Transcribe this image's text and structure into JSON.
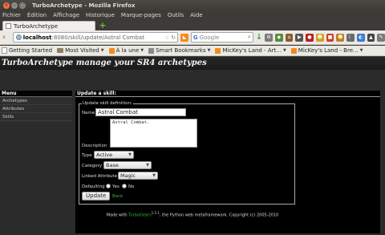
{
  "window": {
    "title": "TurboArchetype - Mozilla Firefox"
  },
  "menubar": [
    "Fichier",
    "Édition",
    "Affichage",
    "Historique",
    "Marque-pages",
    "Outils",
    "Aide"
  ],
  "tab": {
    "title": "TurboArchetype"
  },
  "navbar": {
    "url_host": "localhost",
    "url_rest": ":8080/skill/update/Astral Combat",
    "search_engine": "G",
    "search_placeholder": "Google"
  },
  "bookmarks": [
    {
      "label": "Getting Started",
      "icon": "page-icon",
      "caret": false
    },
    {
      "label": "Most Visited",
      "icon": "folder-icon",
      "caret": true
    },
    {
      "label": "À la une",
      "icon": "rss-icon",
      "caret": true
    },
    {
      "label": "Smart Bookmarks",
      "icon": "bars-icon",
      "caret": true
    },
    {
      "label": "MicKey's Land - Art...",
      "icon": "rss-icon",
      "caret": true
    },
    {
      "label": "MicKey's Land - Bre...",
      "icon": "rss-icon",
      "caret": true
    }
  ],
  "page": {
    "banner": "TurboArchetype manage your SR4 archetypes",
    "sidebar": {
      "heading": "Menu",
      "items": [
        "Archetypes",
        "Attributes",
        "Skills"
      ]
    },
    "main": {
      "heading": "Update a skill:",
      "legend": "Update skill definition:",
      "name_label": "Name",
      "name_value": "Astral Combat",
      "description_label": "Description",
      "description_value": "Astral Combat.",
      "type_label": "Type",
      "type_value": "Active",
      "category_label": "Category",
      "category_value": "Base",
      "linked_label": "Linked Attribute",
      "linked_value": "Magic",
      "defaulting_label": "Defaulting",
      "yes_label": "Yes",
      "no_label": "No",
      "update_button": "Update",
      "back_link": "Back"
    },
    "footer": {
      "prefix": "Made with",
      "framework": "TurboGears",
      "version": "1.5.1",
      "suffix": ", the Python web metaframework. Copyright (c) 2005-2010"
    }
  }
}
